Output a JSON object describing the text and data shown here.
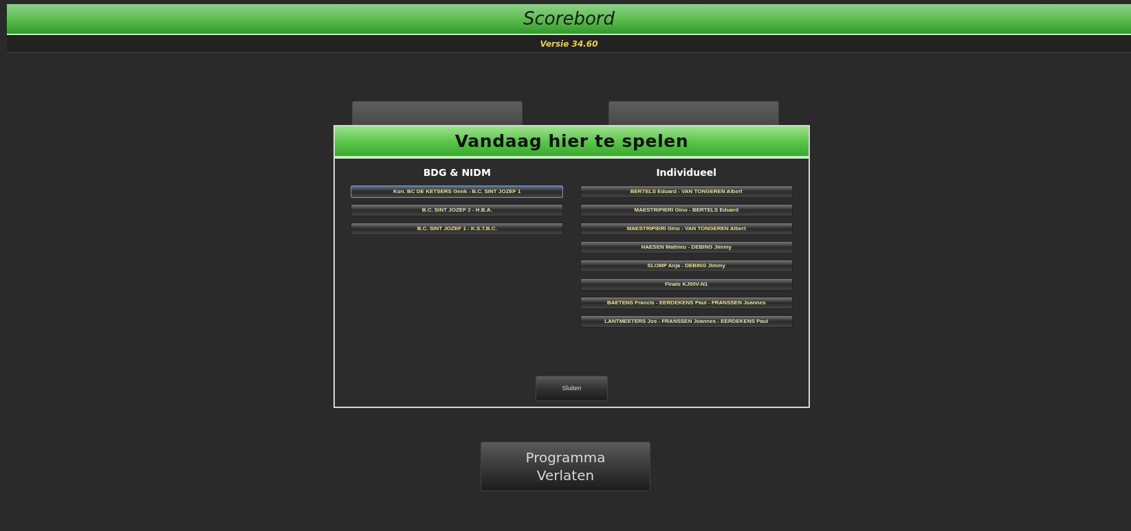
{
  "header": {
    "title": "Scorebord",
    "version": "Versie 34.60"
  },
  "dialog": {
    "title": "Vandaag hier te spelen",
    "columns": [
      {
        "heading": "BDG & NIDM",
        "items": [
          {
            "label": "Kon. BC DE KETSERS Genk - B.C. SINT JOZEF 1",
            "selected": true
          },
          {
            "label": "B.C. SINT JOZEF 2 - H.B.A.",
            "selected": false
          },
          {
            "label": "B.C. SINT JOZEF 1 - K.S.T.B.C.",
            "selected": false
          }
        ]
      },
      {
        "heading": "Individueel",
        "items": [
          {
            "label": "BERTELS Eduard - VAN TONGEREN Albert",
            "selected": false
          },
          {
            "label": "MAESTRIPIERI  Gino - BERTELS Eduard",
            "selected": false
          },
          {
            "label": "MAESTRIPIERI  Gino - VAN TONGEREN Albert",
            "selected": false
          },
          {
            "label": "HAESEN  Mathieu - DEBING Jimmy",
            "selected": false
          },
          {
            "label": "SLOMP  Anja - DEBING Jimmy",
            "selected": false
          },
          {
            "label": "Finale KJ00V-N1",
            "selected": false
          },
          {
            "label": "BAETENS Francis - EERDEKENS Paul - FRANSSEN Joannes",
            "selected": false
          },
          {
            "label": "LANTMEETERS Jos - FRANSSEN Joannes - EERDEKENS Paul",
            "selected": false
          }
        ]
      }
    ],
    "close_button": "Sluiten"
  },
  "exit_button": [
    "Programma",
    "Verlaten"
  ]
}
